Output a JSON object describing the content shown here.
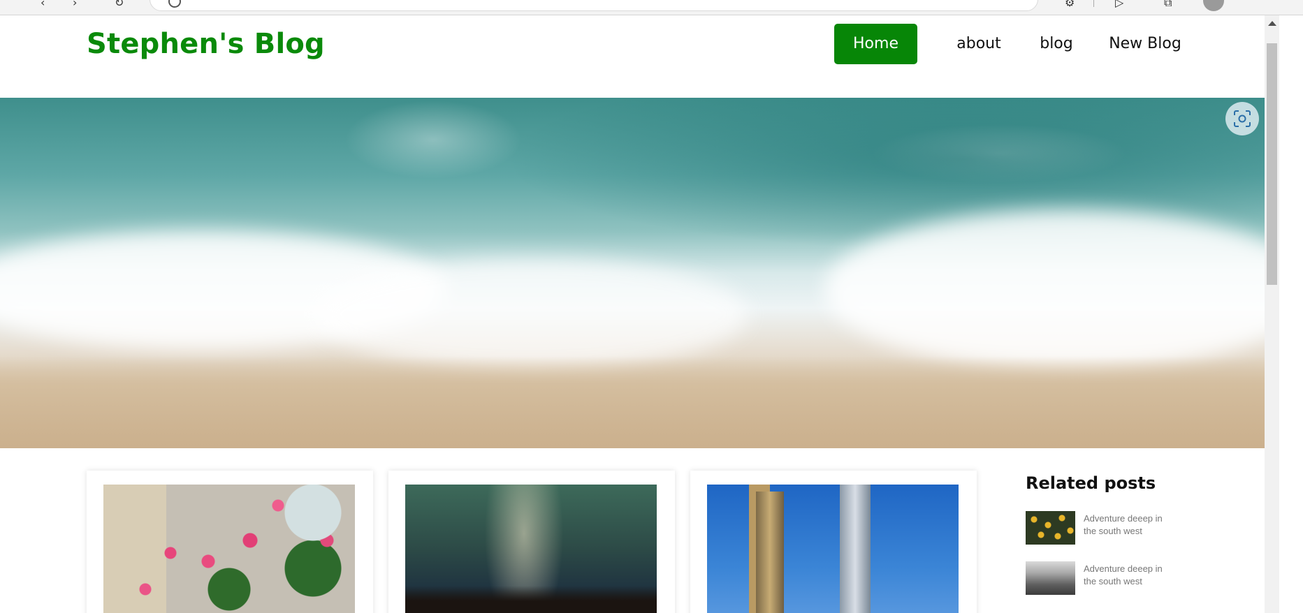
{
  "site": {
    "brand": "Stephen's Blog"
  },
  "nav": {
    "home": "Home",
    "about": "about",
    "blog": "blog",
    "new_blog": "New Blog"
  },
  "hero": {
    "image": "ocean-waves-aerial-photo",
    "lens_icon": "visual-search-icon"
  },
  "cards": [
    {
      "image": "pink-roses-basket-photo"
    },
    {
      "image": "milky-way-night-sky-photo"
    },
    {
      "image": "city-skyscrapers-photo"
    }
  ],
  "related": {
    "title": "Related posts",
    "items": [
      {
        "text": "Adventure deeep in the south west",
        "image": "yellow-flowers-thumbnail"
      },
      {
        "text": "Adventure deeep in the south west",
        "image": "misty-forest-thumbnail"
      }
    ]
  },
  "colors": {
    "brand_green": "#0a8a0a",
    "active_nav_bg": "#078607"
  }
}
